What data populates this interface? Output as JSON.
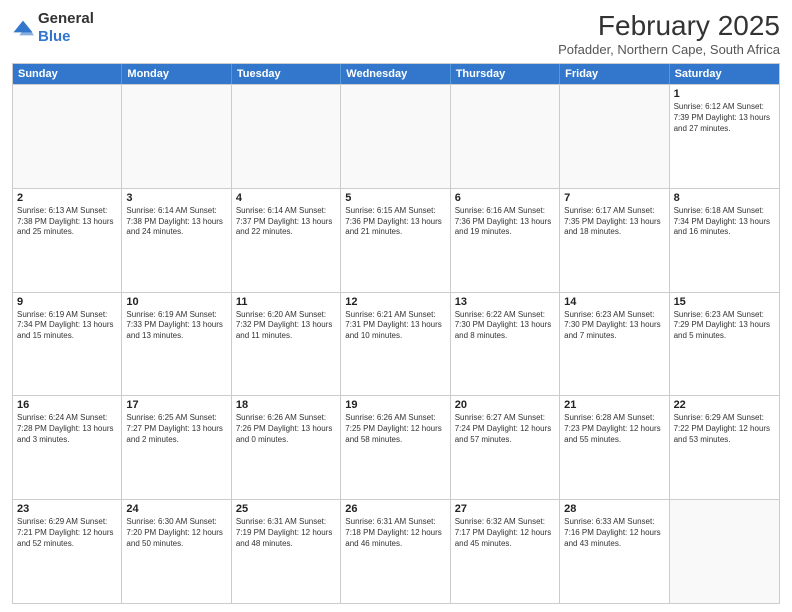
{
  "header": {
    "logo": {
      "general": "General",
      "blue": "Blue"
    },
    "title": "February 2025",
    "location": "Pofadder, Northern Cape, South Africa"
  },
  "calendar": {
    "days": [
      "Sunday",
      "Monday",
      "Tuesday",
      "Wednesday",
      "Thursday",
      "Friday",
      "Saturday"
    ],
    "rows": [
      [
        {
          "day": "",
          "text": ""
        },
        {
          "day": "",
          "text": ""
        },
        {
          "day": "",
          "text": ""
        },
        {
          "day": "",
          "text": ""
        },
        {
          "day": "",
          "text": ""
        },
        {
          "day": "",
          "text": ""
        },
        {
          "day": "1",
          "text": "Sunrise: 6:12 AM\nSunset: 7:39 PM\nDaylight: 13 hours and 27 minutes."
        }
      ],
      [
        {
          "day": "2",
          "text": "Sunrise: 6:13 AM\nSunset: 7:38 PM\nDaylight: 13 hours and 25 minutes."
        },
        {
          "day": "3",
          "text": "Sunrise: 6:14 AM\nSunset: 7:38 PM\nDaylight: 13 hours and 24 minutes."
        },
        {
          "day": "4",
          "text": "Sunrise: 6:14 AM\nSunset: 7:37 PM\nDaylight: 13 hours and 22 minutes."
        },
        {
          "day": "5",
          "text": "Sunrise: 6:15 AM\nSunset: 7:36 PM\nDaylight: 13 hours and 21 minutes."
        },
        {
          "day": "6",
          "text": "Sunrise: 6:16 AM\nSunset: 7:36 PM\nDaylight: 13 hours and 19 minutes."
        },
        {
          "day": "7",
          "text": "Sunrise: 6:17 AM\nSunset: 7:35 PM\nDaylight: 13 hours and 18 minutes."
        },
        {
          "day": "8",
          "text": "Sunrise: 6:18 AM\nSunset: 7:34 PM\nDaylight: 13 hours and 16 minutes."
        }
      ],
      [
        {
          "day": "9",
          "text": "Sunrise: 6:19 AM\nSunset: 7:34 PM\nDaylight: 13 hours and 15 minutes."
        },
        {
          "day": "10",
          "text": "Sunrise: 6:19 AM\nSunset: 7:33 PM\nDaylight: 13 hours and 13 minutes."
        },
        {
          "day": "11",
          "text": "Sunrise: 6:20 AM\nSunset: 7:32 PM\nDaylight: 13 hours and 11 minutes."
        },
        {
          "day": "12",
          "text": "Sunrise: 6:21 AM\nSunset: 7:31 PM\nDaylight: 13 hours and 10 minutes."
        },
        {
          "day": "13",
          "text": "Sunrise: 6:22 AM\nSunset: 7:30 PM\nDaylight: 13 hours and 8 minutes."
        },
        {
          "day": "14",
          "text": "Sunrise: 6:23 AM\nSunset: 7:30 PM\nDaylight: 13 hours and 7 minutes."
        },
        {
          "day": "15",
          "text": "Sunrise: 6:23 AM\nSunset: 7:29 PM\nDaylight: 13 hours and 5 minutes."
        }
      ],
      [
        {
          "day": "16",
          "text": "Sunrise: 6:24 AM\nSunset: 7:28 PM\nDaylight: 13 hours and 3 minutes."
        },
        {
          "day": "17",
          "text": "Sunrise: 6:25 AM\nSunset: 7:27 PM\nDaylight: 13 hours and 2 minutes."
        },
        {
          "day": "18",
          "text": "Sunrise: 6:26 AM\nSunset: 7:26 PM\nDaylight: 13 hours and 0 minutes."
        },
        {
          "day": "19",
          "text": "Sunrise: 6:26 AM\nSunset: 7:25 PM\nDaylight: 12 hours and 58 minutes."
        },
        {
          "day": "20",
          "text": "Sunrise: 6:27 AM\nSunset: 7:24 PM\nDaylight: 12 hours and 57 minutes."
        },
        {
          "day": "21",
          "text": "Sunrise: 6:28 AM\nSunset: 7:23 PM\nDaylight: 12 hours and 55 minutes."
        },
        {
          "day": "22",
          "text": "Sunrise: 6:29 AM\nSunset: 7:22 PM\nDaylight: 12 hours and 53 minutes."
        }
      ],
      [
        {
          "day": "23",
          "text": "Sunrise: 6:29 AM\nSunset: 7:21 PM\nDaylight: 12 hours and 52 minutes."
        },
        {
          "day": "24",
          "text": "Sunrise: 6:30 AM\nSunset: 7:20 PM\nDaylight: 12 hours and 50 minutes."
        },
        {
          "day": "25",
          "text": "Sunrise: 6:31 AM\nSunset: 7:19 PM\nDaylight: 12 hours and 48 minutes."
        },
        {
          "day": "26",
          "text": "Sunrise: 6:31 AM\nSunset: 7:18 PM\nDaylight: 12 hours and 46 minutes."
        },
        {
          "day": "27",
          "text": "Sunrise: 6:32 AM\nSunset: 7:17 PM\nDaylight: 12 hours and 45 minutes."
        },
        {
          "day": "28",
          "text": "Sunrise: 6:33 AM\nSunset: 7:16 PM\nDaylight: 12 hours and 43 minutes."
        },
        {
          "day": "",
          "text": ""
        }
      ]
    ]
  }
}
